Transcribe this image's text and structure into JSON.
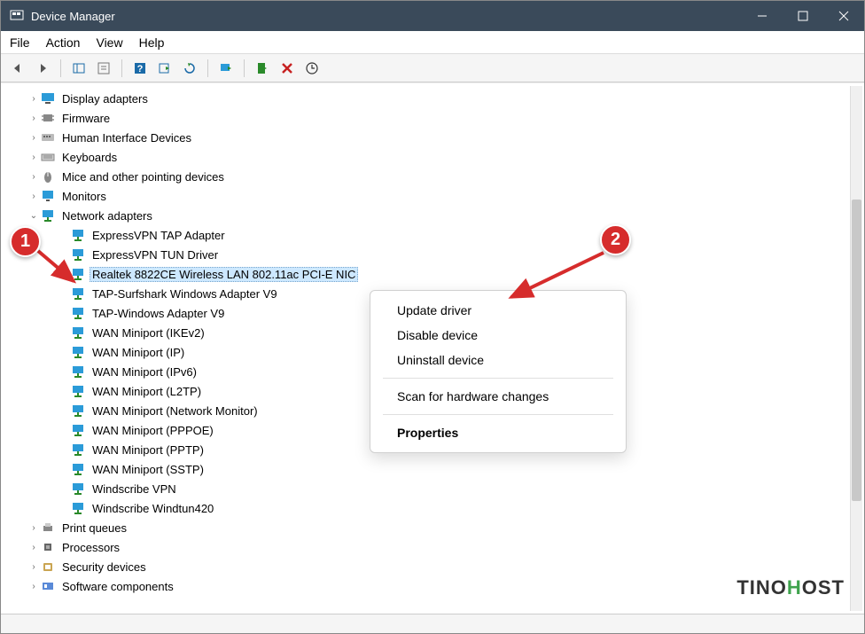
{
  "window": {
    "title": "Device Manager"
  },
  "menu": {
    "file": "File",
    "action": "Action",
    "view": "View",
    "help": "Help"
  },
  "tree": {
    "categories": [
      {
        "label": "Display adapters",
        "icon": "display"
      },
      {
        "label": "Firmware",
        "icon": "chip"
      },
      {
        "label": "Human Interface Devices",
        "icon": "hid"
      },
      {
        "label": "Keyboards",
        "icon": "keyboard"
      },
      {
        "label": "Mice and other pointing devices",
        "icon": "mouse"
      },
      {
        "label": "Monitors",
        "icon": "monitor"
      }
    ],
    "network": {
      "label": "Network adapters",
      "items": [
        "ExpressVPN TAP Adapter",
        "ExpressVPN TUN Driver",
        "Realtek 8822CE Wireless LAN 802.11ac PCI-E NIC",
        "TAP-Surfshark Windows Adapter V9",
        "TAP-Windows Adapter V9",
        "WAN Miniport (IKEv2)",
        "WAN Miniport (IP)",
        "WAN Miniport (IPv6)",
        "WAN Miniport (L2TP)",
        "WAN Miniport (Network Monitor)",
        "WAN Miniport (PPPOE)",
        "WAN Miniport (PPTP)",
        "WAN Miniport (SSTP)",
        "Windscribe VPN",
        "Windscribe Windtun420"
      ],
      "selected_index": 2
    },
    "after": [
      {
        "label": "Print queues",
        "icon": "printer"
      },
      {
        "label": "Processors",
        "icon": "cpu"
      },
      {
        "label": "Security devices",
        "icon": "security"
      },
      {
        "label": "Software components",
        "icon": "sw"
      }
    ]
  },
  "context_menu": {
    "update": "Update driver",
    "disable": "Disable device",
    "uninstall": "Uninstall device",
    "scan": "Scan for hardware changes",
    "properties": "Properties"
  },
  "callouts": {
    "c1": "1",
    "c2": "2"
  },
  "watermark": {
    "prefix": "TINO",
    "accent": "H",
    "suffix": "OST"
  }
}
